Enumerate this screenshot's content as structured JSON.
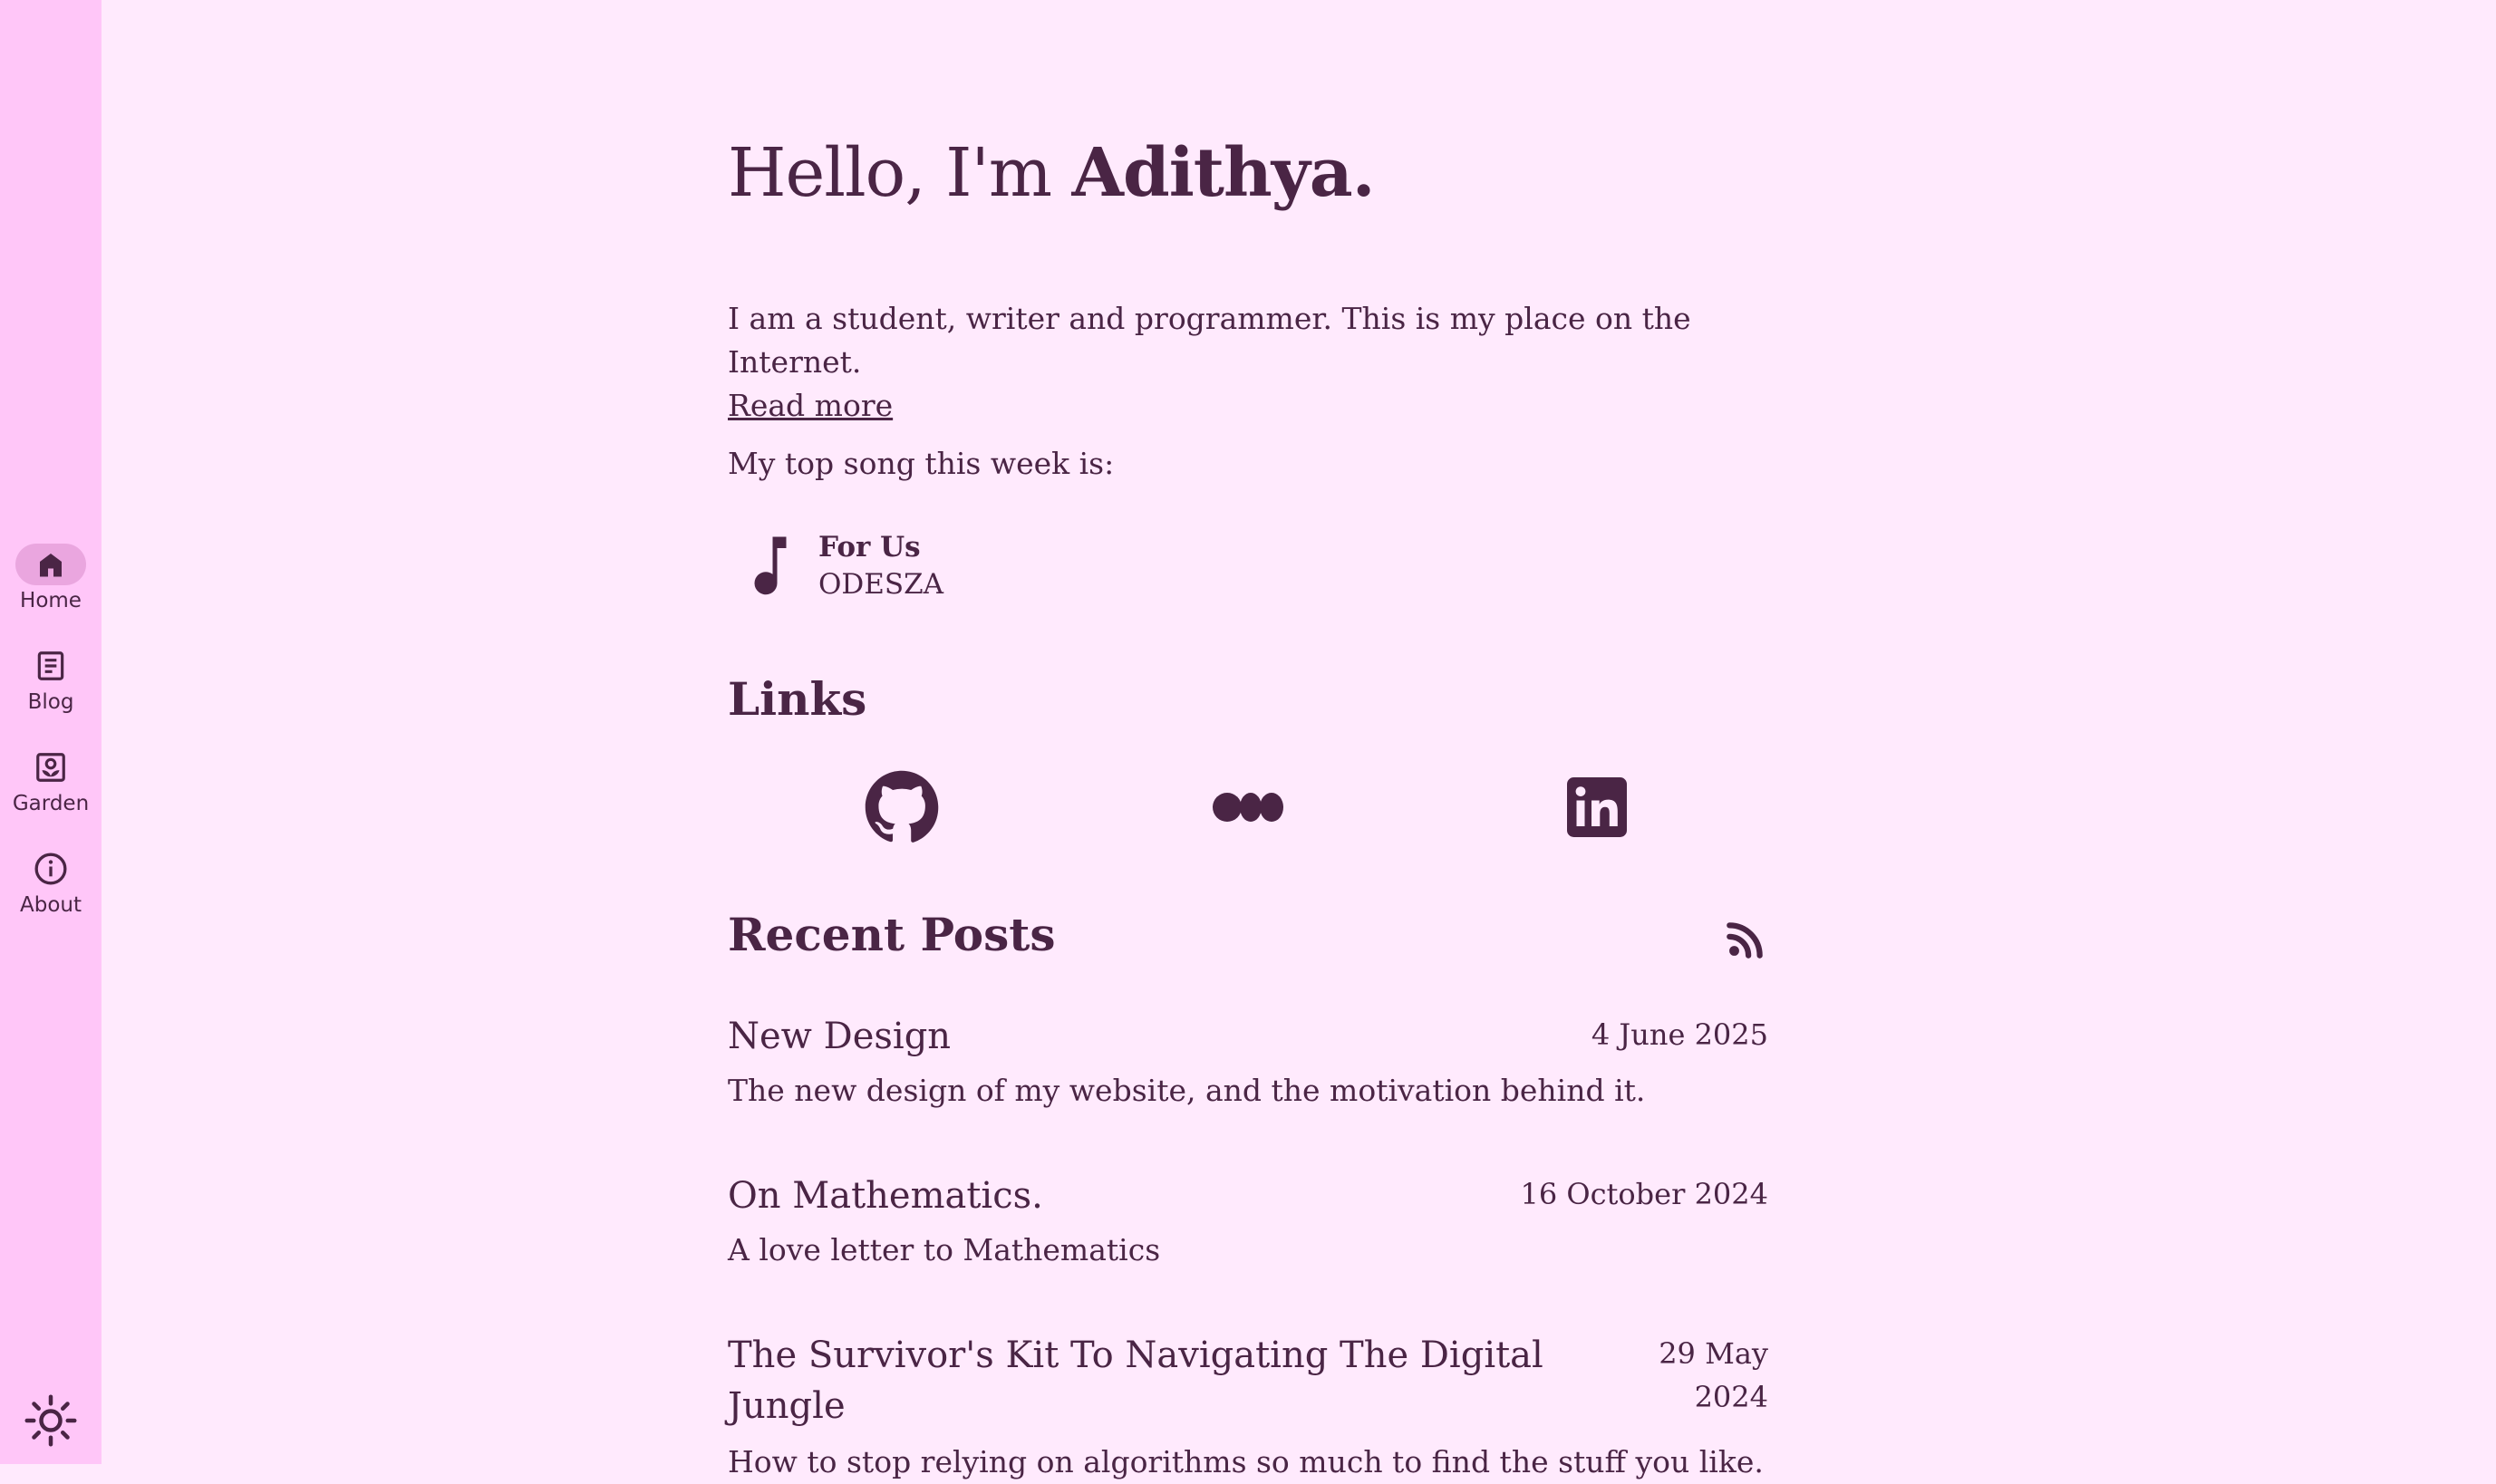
{
  "nav": {
    "items": [
      {
        "label": "Home",
        "icon": "home-icon",
        "active": true
      },
      {
        "label": "Blog",
        "icon": "article-icon"
      },
      {
        "label": "Garden",
        "icon": "garden-icon"
      },
      {
        "label": "About",
        "icon": "info-icon"
      }
    ],
    "theme_icon": "sun-icon"
  },
  "hero": {
    "greeting": "Hello, I'm ",
    "name": "Adithya."
  },
  "intro": {
    "text": "I am a student, writer and programmer. This is my place on the Internet.",
    "read_more": "Read more",
    "song_intro": "My top song this week is:"
  },
  "song": {
    "title": "For Us",
    "artist": "ODESZA",
    "icon": "music-note-icon"
  },
  "links": {
    "heading": "Links",
    "items": [
      "github-icon",
      "medium-icon",
      "linkedin-icon"
    ]
  },
  "recent_posts": {
    "heading": "Recent Posts",
    "rss_icon": "rss-icon",
    "posts": [
      {
        "title": "New Design",
        "date": "4 June 2025",
        "description": "The new design of my website, and the motivation behind it."
      },
      {
        "title": "On Mathematics.",
        "date": "16 October 2024",
        "description": "A love letter to Mathematics"
      },
      {
        "title": "The Survivor's Kit To Navigating The Digital Jungle",
        "date": "29 May 2024",
        "description": "How to stop relying on algorithms so much to find the stuff you like."
      }
    ]
  },
  "colors": {
    "background": "#ffeafd",
    "sidebar": "#ffc6f8",
    "active_pill": "#eaa6df",
    "text": "#4a2545"
  }
}
